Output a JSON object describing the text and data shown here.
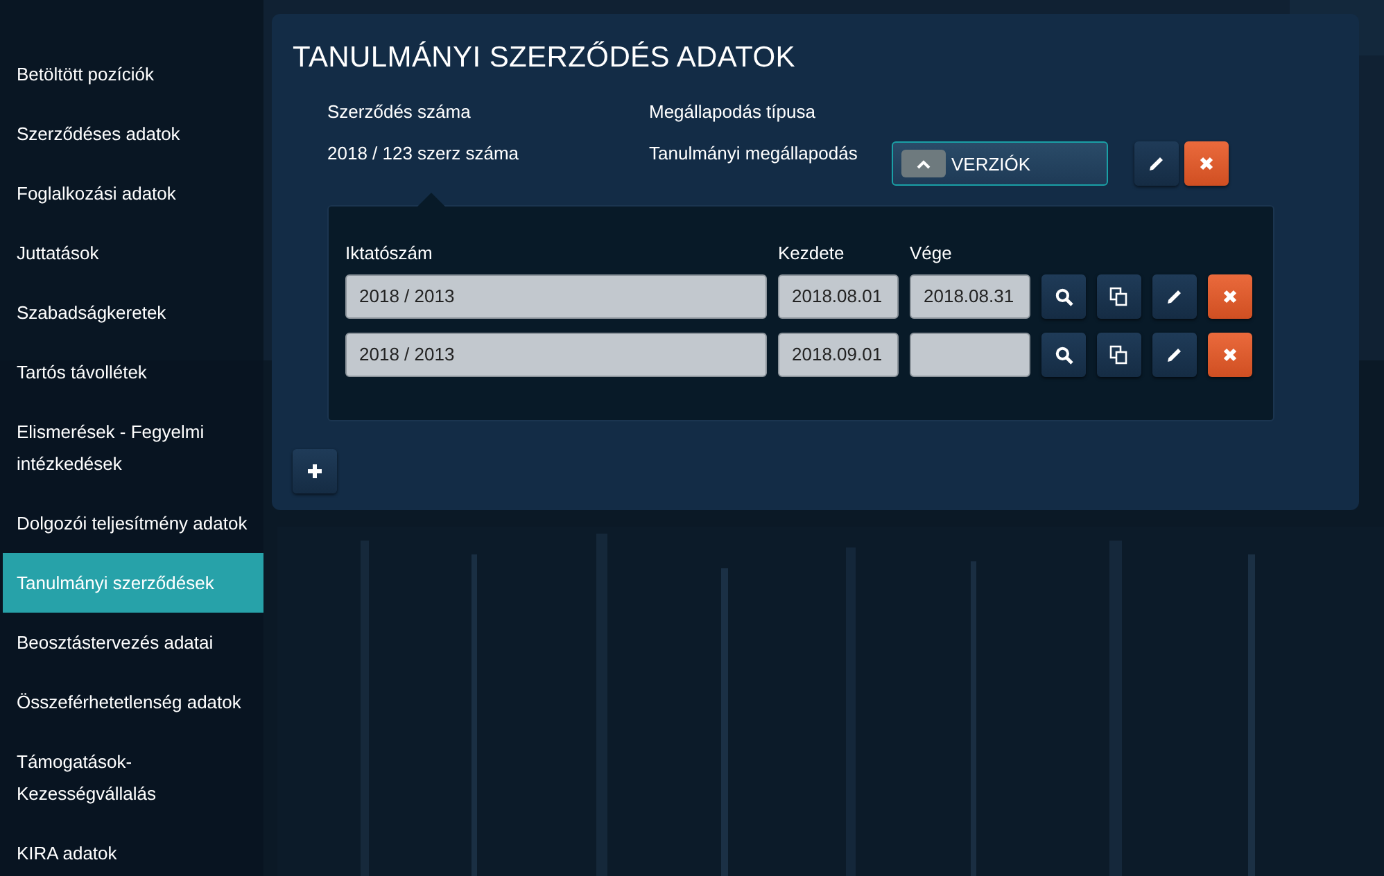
{
  "sidebar": {
    "items": [
      {
        "label": "Betöltött pozíciók",
        "selected": false
      },
      {
        "label": "Szerződéses adatok",
        "selected": false
      },
      {
        "label": "Foglalkozási adatok",
        "selected": false
      },
      {
        "label": "Juttatások",
        "selected": false
      },
      {
        "label": "Szabadságkeretek",
        "selected": false
      },
      {
        "label": "Tartós távollétek",
        "selected": false
      },
      {
        "label": "Elismerések - Fegyelmi intézkedések",
        "selected": false
      },
      {
        "label": "Dolgozói teljesítmény adatok",
        "selected": false
      },
      {
        "label": "Tanulmányi szerződések",
        "selected": true
      },
      {
        "label": "Beosztástervezés adatai",
        "selected": false
      },
      {
        "label": "Összeférhetetlenség adatok",
        "selected": false
      },
      {
        "label": "Támogatások-Kezességvállalás",
        "selected": false
      },
      {
        "label": "KIRA adatok",
        "selected": false
      }
    ]
  },
  "panel": {
    "title": "TANULMÁNYI SZERZŐDÉS ADATOK",
    "fields": [
      {
        "label": "Szerződés száma",
        "value": "2018 / 123 szerz száma"
      },
      {
        "label": "Megállapodás típusa",
        "value": "Tanulmányi megállapodás"
      }
    ],
    "versions_button": {
      "label": "VERZIÓK",
      "expanded": true
    },
    "versions": {
      "columns": [
        "Iktatószám",
        "Kezdete",
        "Vége"
      ],
      "rows": [
        {
          "number": "2018 / 2013",
          "start": "2018.08.01",
          "end": "2018.08.31"
        },
        {
          "number": "2018 / 2013",
          "start": "2018.09.01"
        }
      ]
    }
  }
}
